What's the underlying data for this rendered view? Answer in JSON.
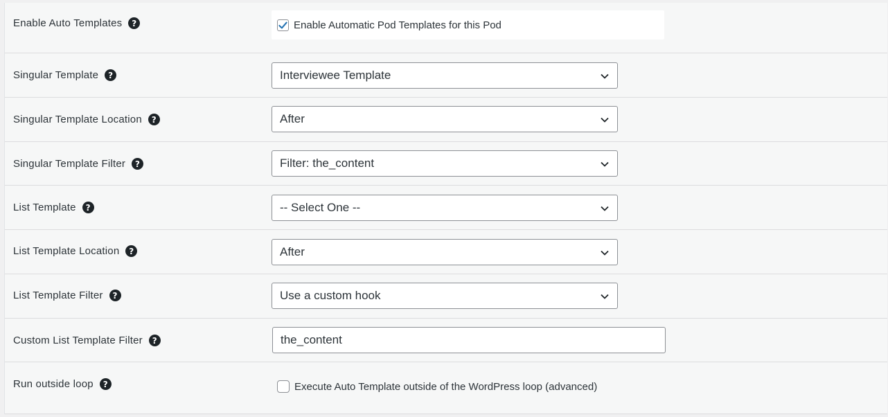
{
  "rows": [
    {
      "label": "Enable Auto Templates",
      "type": "checkbox",
      "checked": true,
      "checkbox_label": "Enable Automatic Pod Templates for this Pod"
    },
    {
      "label": "Singular Template",
      "type": "select",
      "value": "Interviewee Template"
    },
    {
      "label": "Singular Template Location",
      "type": "select",
      "value": "After"
    },
    {
      "label": "Singular Template Filter",
      "type": "select",
      "value": "Filter: the_content"
    },
    {
      "label": "List Template",
      "type": "select",
      "value": "-- Select One --"
    },
    {
      "label": "List Template Location",
      "type": "select",
      "value": "After"
    },
    {
      "label": "List Template Filter",
      "type": "select",
      "value": "Use a custom hook"
    },
    {
      "label": "Custom List Template Filter",
      "type": "text",
      "value": "the_content"
    },
    {
      "label": "Run outside loop",
      "type": "checkbox",
      "checked": false,
      "checkbox_label": "Execute Auto Template outside of the WordPress loop (advanced)"
    }
  ],
  "help_icon_glyph": "?",
  "icons": {
    "help": "question-circle-icon",
    "dropdown": "chevron-down-icon",
    "check": "checkmark-icon"
  },
  "colors": {
    "accent": "#2271b1",
    "border": "#8c8f94",
    "background": "#f6f7f7"
  }
}
